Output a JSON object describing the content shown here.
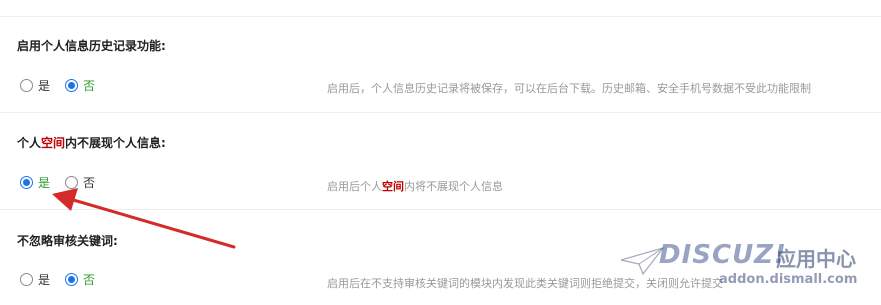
{
  "sections": [
    {
      "title": "启用个人信息历史记录功能:",
      "options": [
        {
          "label": "是",
          "checked": false
        },
        {
          "label": "否",
          "checked": true
        }
      ],
      "description": "启用后，个人信息历史记录将被保存，可以在后台下载。历史邮箱、安全手机号数据不受此功能限制"
    },
    {
      "title_pre": "个人",
      "title_hl": "空间",
      "title_post": "内不展现个人信息:",
      "options": [
        {
          "label": "是",
          "checked": true
        },
        {
          "label": "否",
          "checked": false
        }
      ],
      "desc_pre": "启用后个人",
      "desc_hl": "空间",
      "desc_post": "内将不展现个人信息"
    },
    {
      "title": "不忽略审核关键词:",
      "options": [
        {
          "label": "是",
          "checked": false
        },
        {
          "label": "否",
          "checked": true
        }
      ],
      "description": "启用后在不支持审核关键词的模块内发现此类关键词则拒绝提交，关闭则允许提交"
    }
  ],
  "watermark": {
    "logo": "DISCUZ!",
    "cn": "应用中心",
    "url": "addon.dismall.com"
  },
  "colors": {
    "radio_checked": "#1a73e8",
    "highlight": "#c00000",
    "selected_label": "#2e9a2e",
    "arrow": "#d42a2a"
  }
}
